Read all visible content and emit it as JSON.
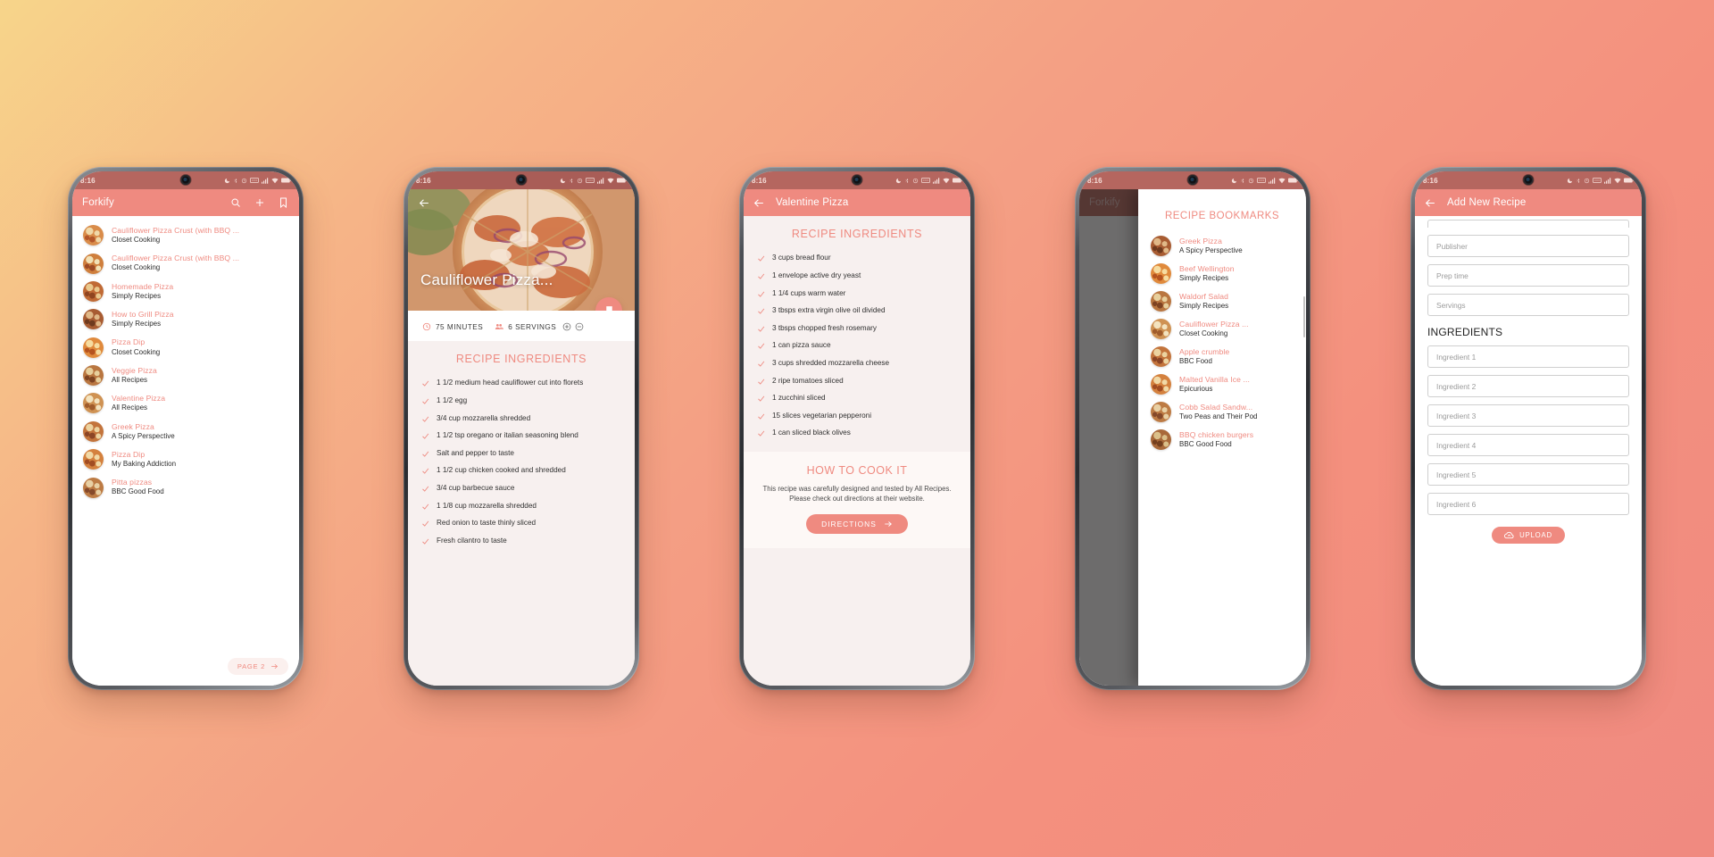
{
  "theme": {
    "accent": "#ef8a80",
    "status_bar": "#b5665f",
    "panel": "#f7f0ef",
    "text_dark": "#2e2e2e"
  },
  "status_bar": {
    "time": "8:16"
  },
  "phone1": {
    "appbar": {
      "title": "Forkify",
      "icons": [
        "search-icon",
        "add-icon",
        "bookmark-icon"
      ]
    },
    "recipes": [
      {
        "title": "Cauliflower Pizza Crust (with BBQ ...",
        "publisher": "Closet Cooking"
      },
      {
        "title": "Cauliflower Pizza Crust (with BBQ ...",
        "publisher": "Closet Cooking"
      },
      {
        "title": "Homemade Pizza",
        "publisher": "Simply Recipes"
      },
      {
        "title": "How to Grill Pizza",
        "publisher": "Simply Recipes"
      },
      {
        "title": "Pizza Dip",
        "publisher": "Closet Cooking"
      },
      {
        "title": "Veggie Pizza",
        "publisher": "All Recipes"
      },
      {
        "title": "Valentine Pizza",
        "publisher": "All Recipes"
      },
      {
        "title": "Greek Pizza",
        "publisher": "A Spicy Perspective"
      },
      {
        "title": "Pizza Dip",
        "publisher": "My Baking Addiction"
      },
      {
        "title": "Pitta pizzas",
        "publisher": "BBC Good Food"
      }
    ],
    "page_button": {
      "label": "PAGE 2",
      "icon": "arrow-right-icon"
    }
  },
  "phone2": {
    "hero_title": "Cauliflower Pizza...",
    "back_icon": "back-arrow-icon",
    "bookmark_fab": "bookmark-icon",
    "meta": {
      "time": "75 MINUTES",
      "servings": "6 SERVINGS",
      "time_icon": "clock-icon",
      "servings_icon": "people-icon",
      "increase_icon": "plus-circle-icon",
      "decrease_icon": "minus-circle-icon"
    },
    "ingredients_heading": "RECIPE INGREDIENTS",
    "ingredients": [
      "1 1/2 medium head cauliflower cut into florets",
      "1 1/2 egg",
      "3/4 cup mozzarella shredded",
      "1 1/2 tsp oregano or italian seasoning blend",
      "Salt and pepper to taste",
      "1 1/2 cup chicken cooked and shredded",
      "3/4 cup barbecue sauce",
      "1 1/8 cup mozzarella shredded",
      "Red onion to taste thinly sliced",
      "Fresh cilantro to taste"
    ]
  },
  "phone3": {
    "appbar": {
      "title": "Valentine Pizza",
      "back_icon": "back-arrow-icon"
    },
    "ingredients_heading": "RECIPE INGREDIENTS",
    "ingredients": [
      "3 cups bread flour",
      "1 envelope active dry yeast",
      "1 1/4 cups warm water",
      "3 tbsps extra virgin olive oil divided",
      "3 tbsps chopped fresh rosemary",
      "1 can pizza sauce",
      "3 cups shredded mozzarella cheese",
      "2 ripe tomatoes sliced",
      "1 zucchini sliced",
      "15 slices vegetarian pepperoni",
      "1 can sliced black olives"
    ],
    "cook": {
      "heading": "HOW TO COOK IT",
      "description": "This recipe was carefully designed and tested by All Recipes. Please check out directions at their website.",
      "button": "DIRECTIONS",
      "button_icon": "arrow-right-icon"
    }
  },
  "phone4": {
    "background_appbar_title": "Forkify",
    "drawer_heading": "RECIPE BOOKMARKS",
    "bookmarks": [
      {
        "title": "Greek Pizza",
        "publisher": "A Spicy Perspective"
      },
      {
        "title": "Beef Wellington",
        "publisher": "Simply Recipes"
      },
      {
        "title": "Waldorf Salad",
        "publisher": "Simply Recipes"
      },
      {
        "title": "Cauliflower Pizza ...",
        "publisher": "Closet Cooking"
      },
      {
        "title": "Apple crumble",
        "publisher": "BBC Food"
      },
      {
        "title": "Malted Vanilla Ice ...",
        "publisher": "Epicurious"
      },
      {
        "title": "Cobb Salad Sandw...",
        "publisher": "Two Peas and Their Pod"
      },
      {
        "title": "BBQ chicken burgers",
        "publisher": "BBC Good Food"
      }
    ]
  },
  "phone5": {
    "appbar": {
      "title": "Add New Recipe",
      "back_icon": "back-arrow-icon"
    },
    "fields": [
      {
        "placeholder": "Publisher"
      },
      {
        "placeholder": "Prep time"
      },
      {
        "placeholder": "Servings"
      }
    ],
    "ingredients_heading": "INGREDIENTS",
    "ingredient_fields": [
      {
        "placeholder": "Ingredient 1"
      },
      {
        "placeholder": "Ingredient 2"
      },
      {
        "placeholder": "Ingredient 3"
      },
      {
        "placeholder": "Ingredient 4"
      },
      {
        "placeholder": "Ingredient 5"
      },
      {
        "placeholder": "Ingredient 6"
      }
    ],
    "upload": {
      "label": "UPLOAD",
      "icon": "cloud-upload-icon"
    }
  }
}
